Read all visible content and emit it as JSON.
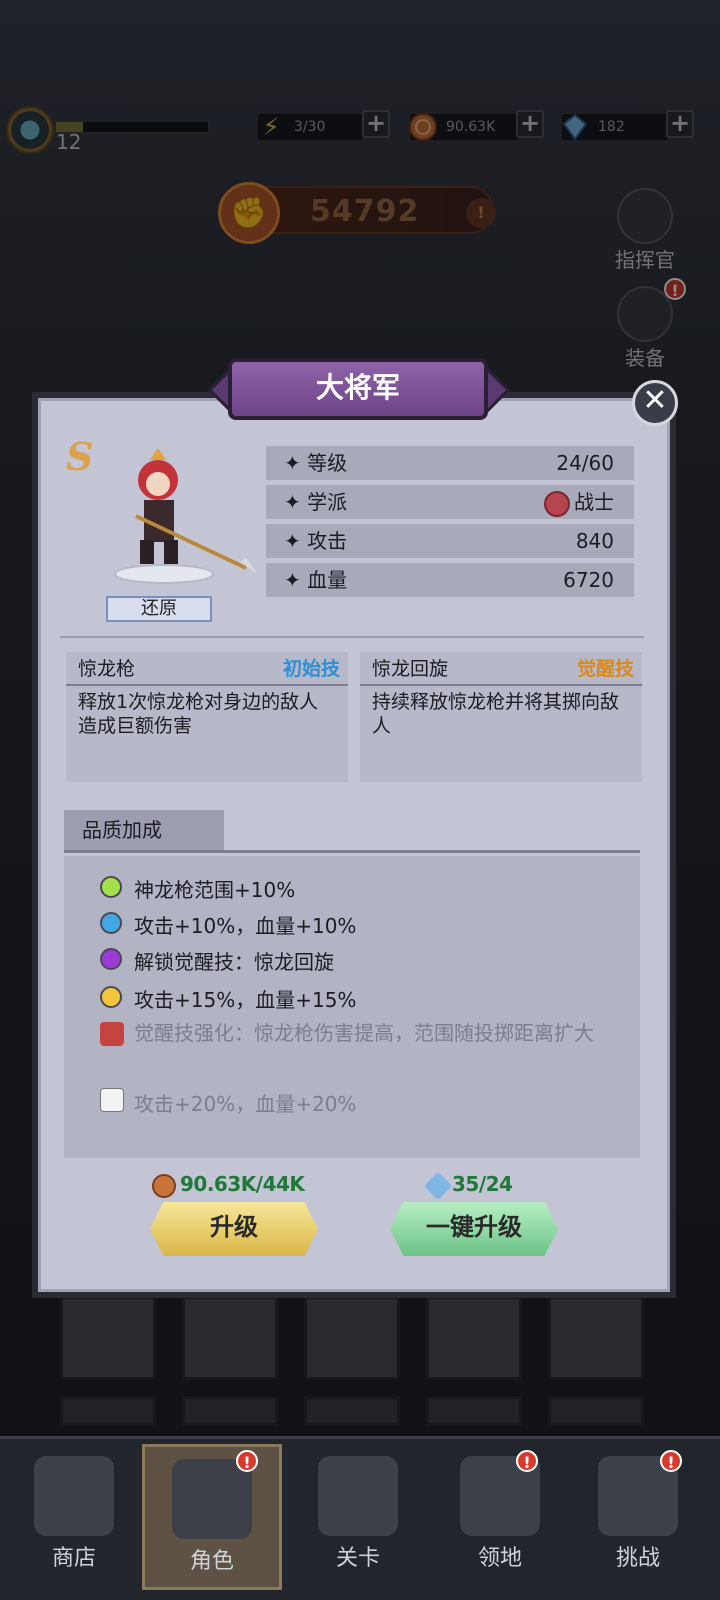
{
  "topbar": {
    "level": "12",
    "xp_fraction": 0.18,
    "energy": "3/30",
    "coins": "90.63K",
    "gems": "182"
  },
  "power": "54792",
  "side": {
    "commander": "指挥官",
    "equipment": "装备"
  },
  "dialog": {
    "title": "大将军",
    "rank": "S",
    "restore": "还原",
    "stats": [
      {
        "label": "等级",
        "value": "24/60"
      },
      {
        "label": "学派",
        "value": "战士"
      },
      {
        "label": "攻击",
        "value": "840"
      },
      {
        "label": "血量",
        "value": "6720"
      }
    ],
    "skills": [
      {
        "name": "惊龙枪",
        "tag": "初始技",
        "tag_color": "#2f8fd6",
        "desc": "释放1次惊龙枪对身边的敌人造成巨额伤害"
      },
      {
        "name": "惊龙回旋",
        "tag": "觉醒技",
        "tag_color": "#d88a1f",
        "desc": "持续释放惊龙枪并将其掷向敌人"
      }
    ],
    "quality": {
      "title": "品质加成",
      "items": [
        {
          "text": "神龙枪范围+10%",
          "color": "#a4e04a",
          "locked": false
        },
        {
          "text": "攻击+10%，血量+10%",
          "color": "#43a7e6",
          "locked": false
        },
        {
          "text": "解锁觉醒技：惊龙回旋",
          "color": "#9b3ad4",
          "locked": false
        },
        {
          "text": "攻击+15%，血量+15%",
          "color": "#f2c53a",
          "locked": false
        },
        {
          "text": "觉醒技强化：惊龙枪伤害提高，范围随投掷距离扩大",
          "locked": true,
          "lock": "red"
        },
        {
          "text": "攻击+20%，血量+20%",
          "locked": true,
          "lock": "white"
        }
      ]
    },
    "cost_coins": "90.63K/44K",
    "cost_gems": "35/24",
    "upgrade": "升级",
    "one_key_upgrade": "一键升级"
  },
  "nav": [
    {
      "label": "商店"
    },
    {
      "label": "角色"
    },
    {
      "label": "关卡"
    },
    {
      "label": "领地"
    },
    {
      "label": "挑战"
    }
  ]
}
